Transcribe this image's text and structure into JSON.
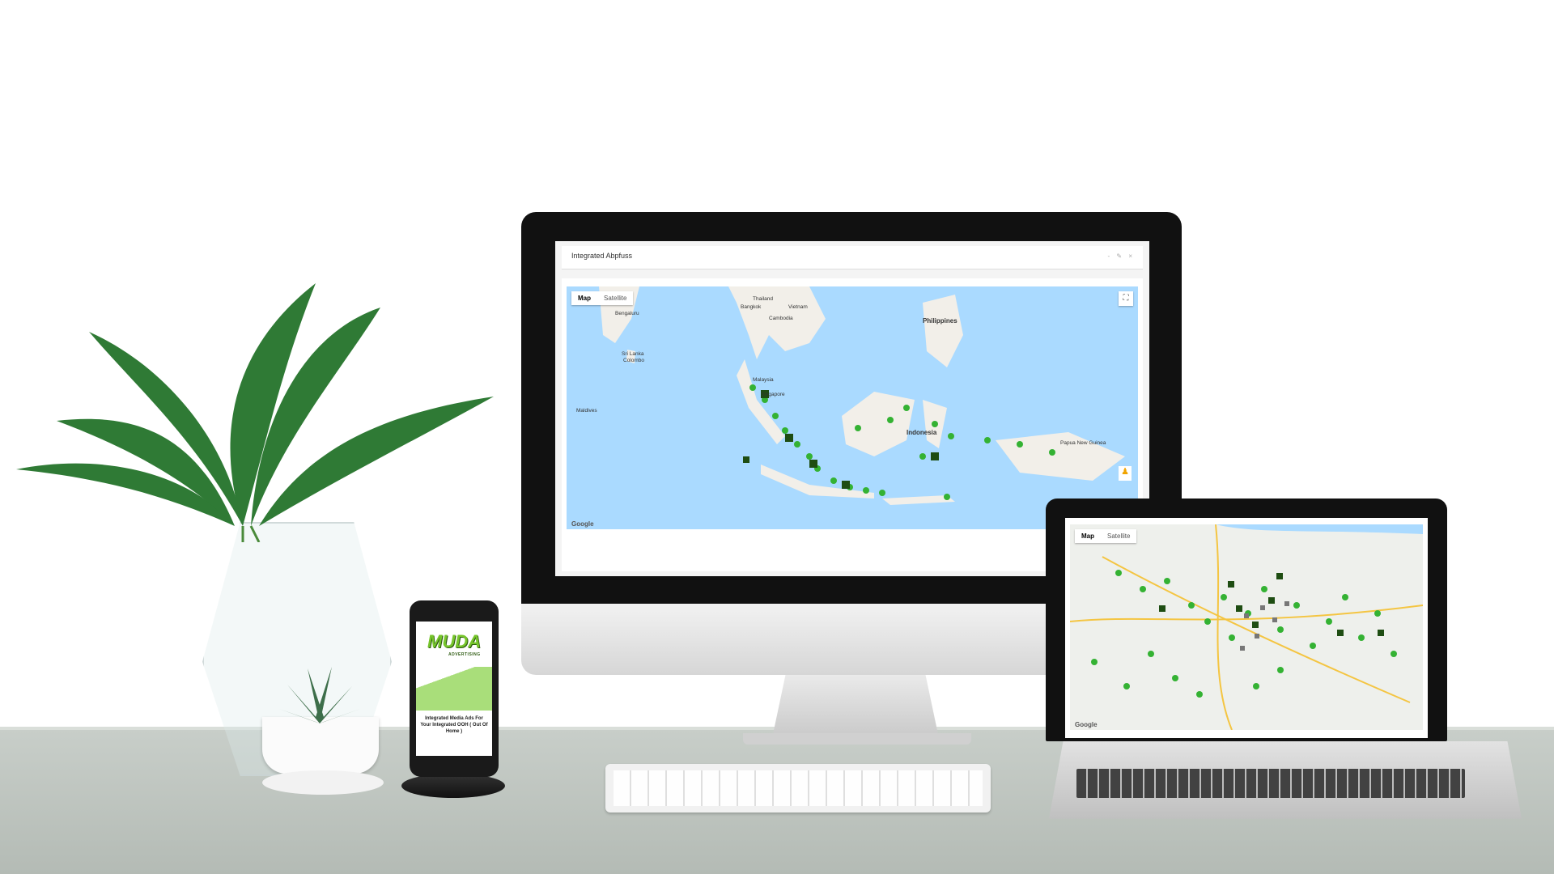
{
  "imac": {
    "panel_title": "Integrated Abpfuss",
    "panel_tools": "- ✎ ×",
    "map": {
      "tabs": [
        "Map",
        "Satellite"
      ],
      "fullscreen": "⛶",
      "google": "Google",
      "places": {
        "thailand": "Thailand",
        "bangkok": "Bangkok",
        "vietnam": "Vietnam",
        "cambodia": "Cambodia",
        "philippines": "Philippines",
        "malaysia": "Malaysia",
        "singapore": "Singapore",
        "srilanka": "Sri Lanka",
        "indonesia": "Indonesia",
        "papua": "Papua New Guinea",
        "bengaluru": "Bengaluru",
        "colombo": "Colombo",
        "maldives": "Maldives"
      }
    }
  },
  "laptop": {
    "map": {
      "tabs": [
        "Map",
        "Satellite"
      ],
      "google": "Google"
    }
  },
  "phone": {
    "logo": "MUDA",
    "logo_sub": "ADVERTISING",
    "tagline": "Integrated Media Ads For Your Integrated OOH ( Out Of Home )"
  },
  "colors": {
    "marker": "#34b233",
    "marker_dark": "#1e4d12",
    "ocean": "#aadaff",
    "land": "#f2efe9"
  }
}
